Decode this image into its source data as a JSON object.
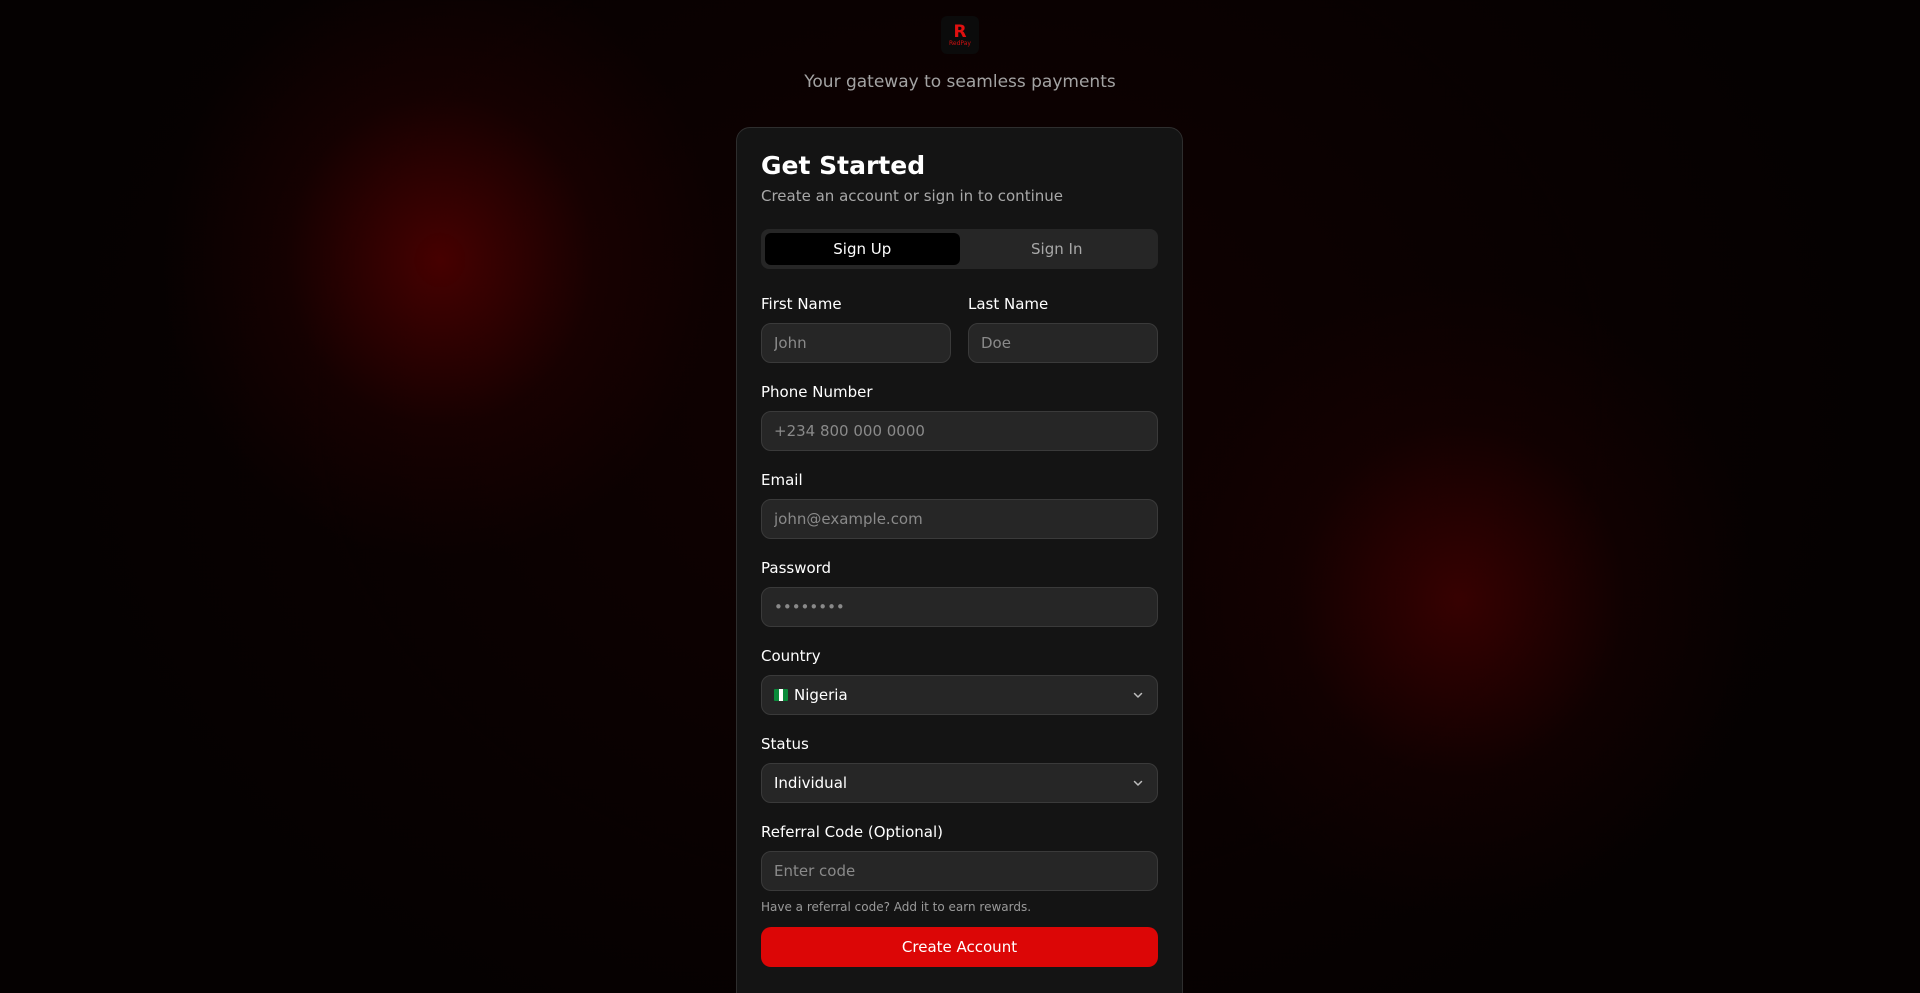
{
  "brand": {
    "logo_mark": "R",
    "logo_text": "RedPay",
    "tagline": "Your gateway to seamless payments",
    "accent_color": "#dc0606"
  },
  "card": {
    "title": "Get Started",
    "subtitle": "Create an account or sign in to continue"
  },
  "tabs": [
    {
      "label": "Sign Up",
      "active": true
    },
    {
      "label": "Sign In",
      "active": false
    }
  ],
  "form": {
    "first_name": {
      "label": "First Name",
      "placeholder": "John"
    },
    "last_name": {
      "label": "Last Name",
      "placeholder": "Doe"
    },
    "phone": {
      "label": "Phone Number",
      "placeholder": "+234 800 000 0000"
    },
    "email": {
      "label": "Email",
      "placeholder": "john@example.com"
    },
    "password": {
      "label": "Password",
      "placeholder": "••••••••"
    },
    "country": {
      "label": "Country",
      "value": "Nigeria",
      "flag_icon": "nigeria-flag-icon"
    },
    "status": {
      "label": "Status",
      "value": "Individual"
    },
    "referral": {
      "label": "Referral Code (Optional)",
      "placeholder": "Enter code",
      "hint": "Have a referral code? Add it to earn rewards."
    },
    "submit_label": "Create Account"
  }
}
